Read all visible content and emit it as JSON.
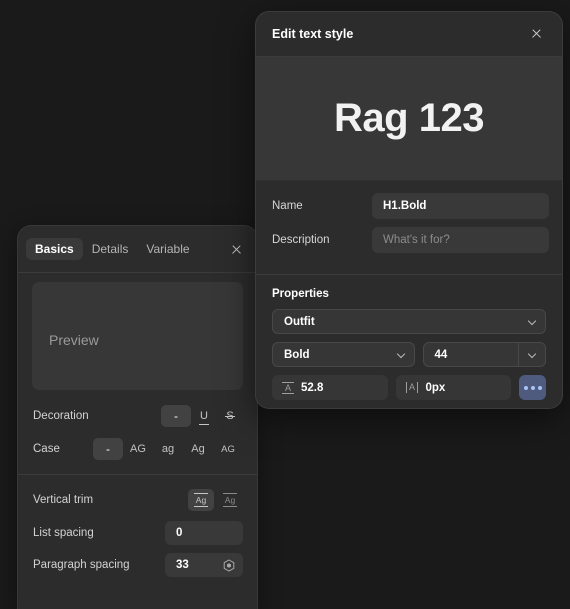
{
  "left_panel": {
    "tabs": [
      {
        "label": "Basics",
        "active": true
      },
      {
        "label": "Details",
        "active": false
      },
      {
        "label": "Variable",
        "active": false
      }
    ],
    "close_icon": "close-icon",
    "preview_placeholder": "Preview",
    "rows": [
      {
        "label": "Decoration",
        "options": [
          {
            "label": "-",
            "name": "none",
            "selected": true
          },
          {
            "label": "U",
            "name": "underline",
            "selected": false
          },
          {
            "label": "S",
            "name": "strikethrough",
            "selected": false
          }
        ]
      },
      {
        "label": "Case",
        "options": [
          {
            "label": "-",
            "name": "none",
            "selected": true
          },
          {
            "label": "AG",
            "name": "uppercase",
            "selected": false
          },
          {
            "label": "ag",
            "name": "lowercase",
            "selected": false
          },
          {
            "label": "Ag",
            "name": "titlecase",
            "selected": false
          },
          {
            "label": "AG",
            "name": "smallcaps",
            "selected": false
          }
        ]
      },
      {
        "label": "Vertical trim",
        "options": [
          {
            "label": "Ag",
            "name": "trim-standard",
            "selected": true
          },
          {
            "label": "Ag",
            "name": "trim-cap-height",
            "selected": false
          }
        ]
      }
    ],
    "list_spacing": {
      "label": "List spacing",
      "value": "0"
    },
    "paragraph_spacing": {
      "label": "Paragraph spacing",
      "value": "33",
      "icon": "variable-hexagon-icon"
    }
  },
  "dialog": {
    "title": "Edit text style",
    "close_icon": "close-icon",
    "preview_text": "Rag 123",
    "fields": [
      {
        "label": "Name",
        "value": "H1.Bold",
        "placeholder": ""
      },
      {
        "label": "Description",
        "value": "",
        "placeholder": "What's it for?"
      }
    ],
    "properties": {
      "title": "Properties",
      "font_family": "Outfit",
      "font_weight": "Bold",
      "font_size": "44",
      "line_height": "52.8",
      "letter_spacing": "0px",
      "more_label": "…"
    }
  },
  "colors": {
    "panel_bg": "#2c2c2c",
    "app_bg": "#1a1a1a",
    "field_bg": "#393939",
    "preview_bg": "#373737",
    "accent_more_button": "#4e5a7e",
    "accent_dot": "#a9c4f5"
  }
}
